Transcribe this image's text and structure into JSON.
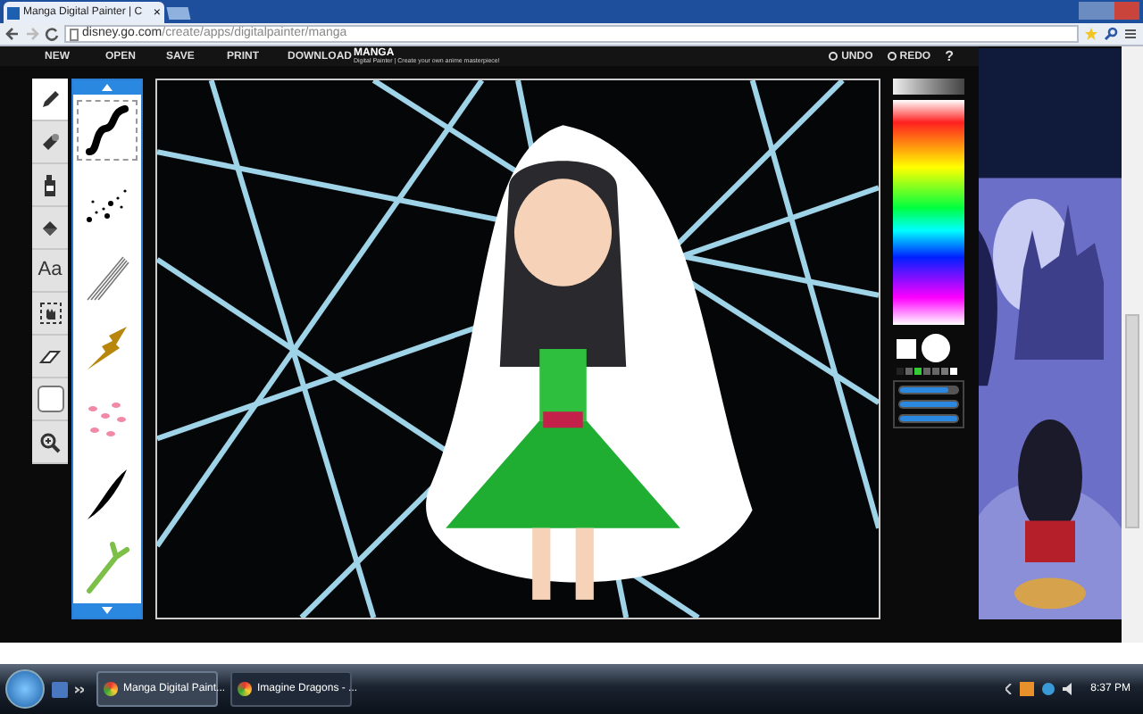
{
  "browser": {
    "tab_title": "Manga Digital Painter | C",
    "tab_close": "×",
    "url_host": "disney.go.com",
    "url_path": "/create/apps/digitalpainter/manga"
  },
  "app": {
    "menu": [
      "NEW",
      "OPEN",
      "SAVE",
      "PRINT",
      "DOWNLOAD"
    ],
    "logo": "MANGA",
    "tagline": "Digital Painter | Create your own anime masterpiece!",
    "undo": "UNDO",
    "redo": "REDO",
    "help": "?"
  },
  "tools": [
    {
      "kind": "pencil",
      "selected": true
    },
    {
      "kind": "stamp",
      "selected": false
    },
    {
      "kind": "spray",
      "selected": false
    },
    {
      "kind": "bucket",
      "selected": false
    },
    {
      "kind": "text",
      "label": "Aa",
      "selected": false
    },
    {
      "kind": "select",
      "selected": false
    },
    {
      "kind": "eraser",
      "selected": false
    },
    {
      "kind": "swatch",
      "selected": false
    },
    {
      "kind": "zoom",
      "selected": false
    }
  ],
  "brushes": [
    {
      "kind": "stroke",
      "selected": true
    },
    {
      "kind": "sparkle",
      "selected": false
    },
    {
      "kind": "lines",
      "selected": false
    },
    {
      "kind": "branch",
      "selected": false
    },
    {
      "kind": "petals",
      "selected": false
    },
    {
      "kind": "leaf",
      "selected": false
    },
    {
      "kind": "stem",
      "selected": false
    }
  ],
  "sliders": [
    {
      "level": 0.85
    },
    {
      "level": 1
    },
    {
      "level": 1
    }
  ],
  "taskbar": {
    "tasks": [
      {
        "label": "Manga Digital Paint...",
        "selected": true
      },
      {
        "label": "Imagine Dragons - ...",
        "selected": false
      }
    ],
    "clock": "8:37 PM"
  }
}
